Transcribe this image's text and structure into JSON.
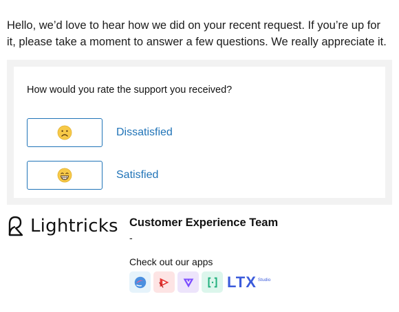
{
  "intro": {
    "text": "Hello, we’d love to hear how we did on your recent request. If you’re up for it, please take a moment to answer a few questions. We really appreciate it."
  },
  "survey": {
    "question": "How would you rate the support you received?",
    "options": [
      {
        "icon": "frowning-face-icon",
        "label": "Dissatisfied"
      },
      {
        "icon": "grinning-face-icon",
        "label": "Satisfied"
      }
    ]
  },
  "signature": {
    "company": "Lightricks",
    "team": "Customer Experience Team",
    "dash": "-",
    "apps_heading": "Check out our apps",
    "apps": [
      {
        "icon": "facetune-app-icon"
      },
      {
        "icon": "videoleap-app-icon"
      },
      {
        "icon": "photoleap-app-icon"
      },
      {
        "icon": "bracket-app-icon"
      },
      {
        "icon": "ltx-studio-logo",
        "text": "LTX",
        "subtext": "Studio"
      }
    ]
  },
  "colors": {
    "accent": "#1f73b7",
    "panel_bg": "#f2f2f2",
    "ltx_blue": "#3b5bdb"
  }
}
